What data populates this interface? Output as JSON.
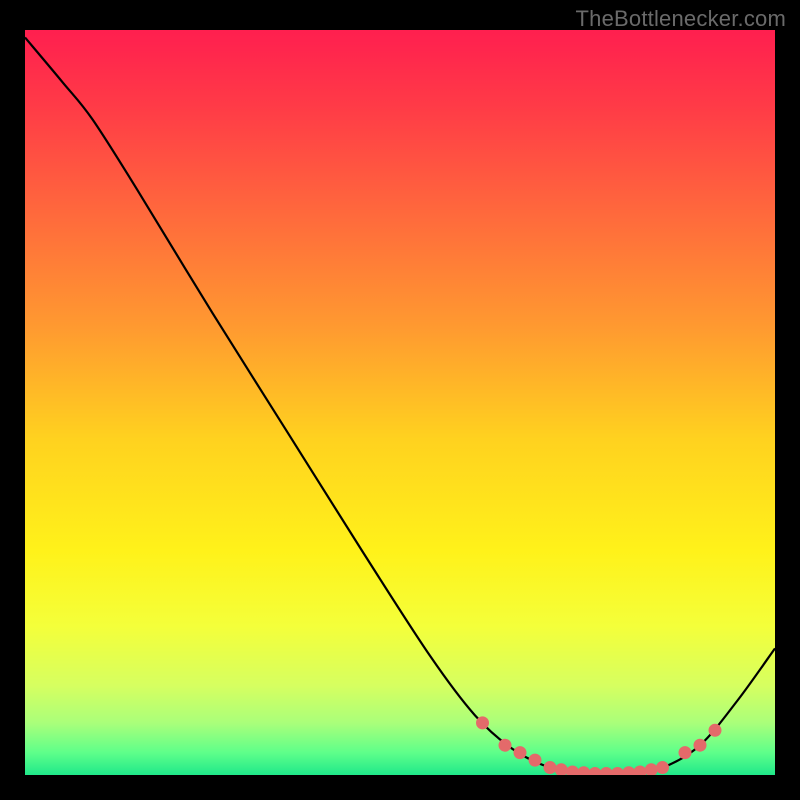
{
  "watermark": "TheBottlenecker.com",
  "chart_data": {
    "type": "line",
    "title": "",
    "xlabel": "",
    "ylabel": "",
    "xlim": [
      0,
      100
    ],
    "ylim": [
      0,
      100
    ],
    "curve": [
      {
        "x": 0.0,
        "y": 99.0
      },
      {
        "x": 5.0,
        "y": 93.0
      },
      {
        "x": 9.0,
        "y": 88.0
      },
      {
        "x": 15.0,
        "y": 78.5
      },
      {
        "x": 25.0,
        "y": 62.0
      },
      {
        "x": 35.0,
        "y": 46.0
      },
      {
        "x": 45.0,
        "y": 30.0
      },
      {
        "x": 54.0,
        "y": 16.0
      },
      {
        "x": 60.0,
        "y": 8.0
      },
      {
        "x": 65.0,
        "y": 3.5
      },
      {
        "x": 70.0,
        "y": 1.0
      },
      {
        "x": 75.0,
        "y": 0.2
      },
      {
        "x": 80.0,
        "y": 0.2
      },
      {
        "x": 85.0,
        "y": 1.0
      },
      {
        "x": 90.0,
        "y": 4.0
      },
      {
        "x": 95.0,
        "y": 10.0
      },
      {
        "x": 100.0,
        "y": 17.0
      }
    ],
    "markers": [
      {
        "x": 61.0,
        "y": 7.0
      },
      {
        "x": 64.0,
        "y": 4.0
      },
      {
        "x": 66.0,
        "y": 3.0
      },
      {
        "x": 68.0,
        "y": 2.0
      },
      {
        "x": 70.0,
        "y": 1.0
      },
      {
        "x": 71.5,
        "y": 0.7
      },
      {
        "x": 73.0,
        "y": 0.4
      },
      {
        "x": 74.5,
        "y": 0.3
      },
      {
        "x": 76.0,
        "y": 0.2
      },
      {
        "x": 77.5,
        "y": 0.2
      },
      {
        "x": 79.0,
        "y": 0.2
      },
      {
        "x": 80.5,
        "y": 0.3
      },
      {
        "x": 82.0,
        "y": 0.4
      },
      {
        "x": 83.5,
        "y": 0.7
      },
      {
        "x": 85.0,
        "y": 1.0
      },
      {
        "x": 88.0,
        "y": 3.0
      },
      {
        "x": 90.0,
        "y": 4.0
      },
      {
        "x": 92.0,
        "y": 6.0
      }
    ],
    "gradient_stops": [
      {
        "offset": 0.0,
        "color": "#ff1f4f"
      },
      {
        "offset": 0.1,
        "color": "#ff3a47"
      },
      {
        "offset": 0.25,
        "color": "#ff6a3c"
      },
      {
        "offset": 0.4,
        "color": "#ff9a30"
      },
      {
        "offset": 0.55,
        "color": "#ffd21f"
      },
      {
        "offset": 0.7,
        "color": "#fff21a"
      },
      {
        "offset": 0.8,
        "color": "#f4ff3a"
      },
      {
        "offset": 0.88,
        "color": "#d6ff60"
      },
      {
        "offset": 0.93,
        "color": "#aaff7a"
      },
      {
        "offset": 0.97,
        "color": "#5eff8a"
      },
      {
        "offset": 1.0,
        "color": "#20e88a"
      }
    ],
    "curve_color": "#000000",
    "marker_color": "#e46a6a"
  }
}
